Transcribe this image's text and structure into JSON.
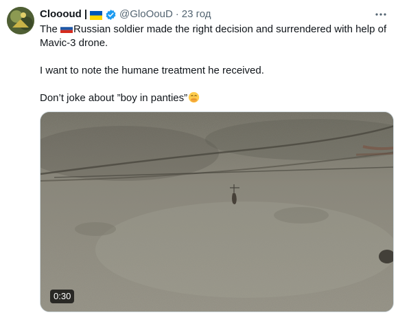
{
  "tweet": {
    "author_name": "Cloooud",
    "separator": "|",
    "author_handle": "@GloOouD",
    "dot": "·",
    "timestamp": "23 год",
    "more_label": "···",
    "line1_part1": "The ",
    "line1_part2": "Russian soldier made the right decision and surrendered with help of Mavic-3 drone.",
    "line2": "I want to note the humane treatment he received.",
    "line3": "Don’t joke about ”boy in panties”",
    "video_duration": "0:30"
  },
  "icons": {
    "avatar": "avatar-image",
    "flag": "ukraine-flag-icon",
    "verified": "verified-badge-icon",
    "ru_flag": "russia-flag-icon",
    "emoji": "face-hand-over-mouth-emoji",
    "more": "more-options-icon"
  },
  "colors": {
    "text": "#0f1419",
    "secondary": "#536471",
    "verified": "#1d9bf0",
    "ua_blue": "#0057b7",
    "ua_yellow": "#ffd700"
  }
}
